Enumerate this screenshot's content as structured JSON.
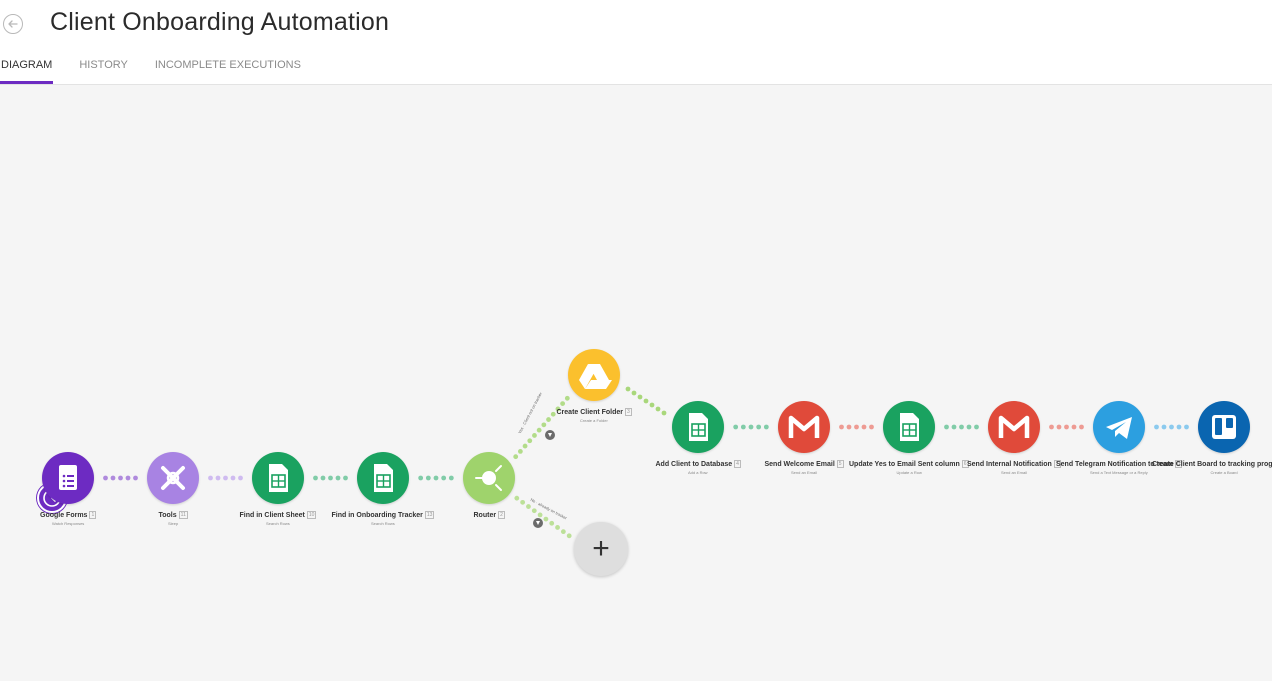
{
  "header": {
    "title": "Client Onboarding Automation",
    "back_icon": "arrow-left-circle-icon"
  },
  "tabs": [
    {
      "label": "DIAGRAM",
      "active": true
    },
    {
      "label": "HISTORY",
      "active": false
    },
    {
      "label": "INCOMPLETE EXECUTIONS",
      "active": false
    }
  ],
  "colors": {
    "accent": "#6d2bc2",
    "forms": "#6d2bc2",
    "tools": "#a883e3",
    "sheets": "#1aa260",
    "router": "#9fd36c",
    "drive": "#fbc02d",
    "gmail": "#e04a3a",
    "telegram": "#2c9fe0",
    "trello": "#0a65b0",
    "canvas": "#f5f5f5"
  },
  "modules": [
    {
      "id": "forms",
      "name": "Google Forms",
      "badge": "1",
      "sub": "Watch Responses",
      "icon": "google-forms-icon",
      "color": "#6d2bc2"
    },
    {
      "id": "tools",
      "name": "Tools",
      "badge": "11",
      "sub": "Sleep",
      "icon": "tools-icon",
      "color": "#a883e3"
    },
    {
      "id": "client-sheet",
      "name": "Find in Client Sheet",
      "badge": "10",
      "sub": "Search Rows",
      "icon": "google-sheets-icon",
      "color": "#1aa260"
    },
    {
      "id": "onboarding",
      "name": "Find in Onboarding Tracker",
      "badge": "13",
      "sub": "Search Rows",
      "icon": "google-sheets-icon",
      "color": "#1aa260"
    },
    {
      "id": "router",
      "name": "Router",
      "badge": "2",
      "sub": "",
      "icon": "router-icon",
      "color": "#9fd36c"
    },
    {
      "id": "folder",
      "name": "Create Client Folder",
      "badge": "3",
      "sub": "Create a Folder",
      "icon": "google-drive-icon",
      "color": "#fbc02d"
    },
    {
      "id": "add-db",
      "name": "Add Client to Database",
      "badge": "4",
      "sub": "Add a Row",
      "icon": "google-sheets-icon",
      "color": "#1aa260"
    },
    {
      "id": "welcome",
      "name": "Send Welcome Email",
      "badge": "5",
      "sub": "Send an Email",
      "icon": "gmail-icon",
      "color": "#e04a3a"
    },
    {
      "id": "update",
      "name": "Update Yes to Email Sent column",
      "badge": "6",
      "sub": "Update a Row",
      "icon": "google-sheets-icon",
      "color": "#1aa260"
    },
    {
      "id": "internal",
      "name": "Send Internal Notification",
      "badge": "7",
      "sub": "Send an Email",
      "icon": "gmail-icon",
      "color": "#e04a3a"
    },
    {
      "id": "telegram",
      "name": "Send Telegram Notification to team",
      "badge": "8",
      "sub": "Send a Text Message or a Reply",
      "icon": "telegram-icon",
      "color": "#2c9fe0"
    },
    {
      "id": "trello",
      "name": "Create Client Board to tracking progress",
      "badge": "9",
      "sub": "Create a Board",
      "icon": "trello-icon",
      "color": "#0a65b0"
    }
  ],
  "routes": [
    {
      "label": "Yes · Client not on tracker"
    },
    {
      "label": "No · already on tracker"
    }
  ],
  "add_icon": "plus-icon"
}
